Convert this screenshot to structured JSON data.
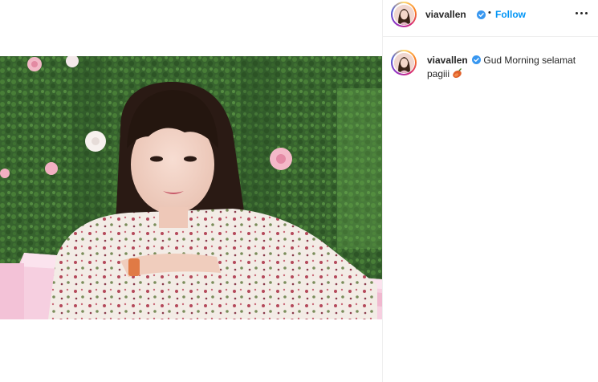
{
  "post": {
    "username": "viavallen",
    "follow_label": "Follow",
    "separator": "•",
    "more_icon": "more-horizontal-icon",
    "verified_icon": "verified-badge-icon"
  },
  "caption": {
    "username": "viavallen",
    "text": "Gud Morning selamat pagiii",
    "emoji_icon": "sweet-potato-emoji"
  },
  "colors": {
    "link_blue": "#0095f6",
    "verified_blue": "#3897f0",
    "text_primary": "#262626",
    "divider": "#efefef"
  }
}
